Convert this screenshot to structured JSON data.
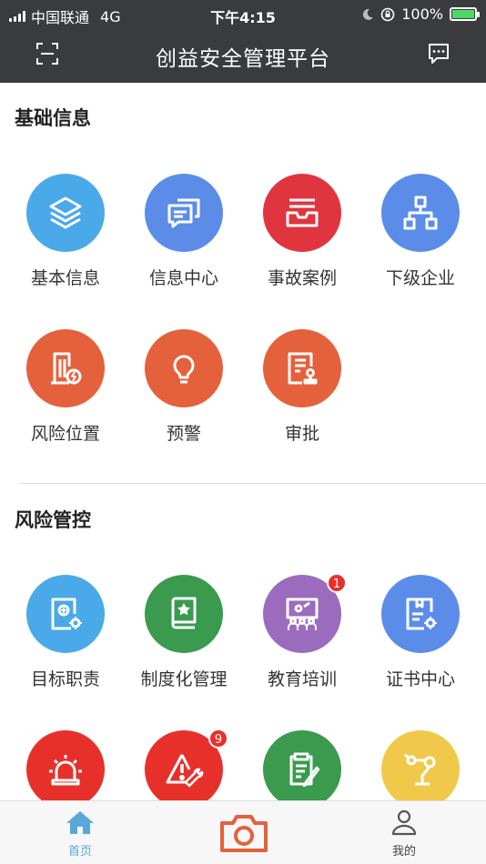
{
  "status_bar": {
    "carrier": "中国联通",
    "network": "4G",
    "time": "下午4:15",
    "battery": "100%"
  },
  "header": {
    "title": "创益安全管理平台"
  },
  "sections": [
    {
      "title": "基础信息",
      "items": [
        {
          "label": "基本信息",
          "icon": "layers-icon",
          "color": "#4aa9e8"
        },
        {
          "label": "信息中心",
          "icon": "chat-bubbles-icon",
          "color": "#5b8de8"
        },
        {
          "label": "事故案例",
          "icon": "inbox-tray-icon",
          "color": "#e0353f"
        },
        {
          "label": "下级企业",
          "icon": "org-chart-icon",
          "color": "#5b8de8"
        },
        {
          "label": "风险位置",
          "icon": "building-alert-icon",
          "color": "#e4613c"
        },
        {
          "label": "预警",
          "icon": "lightbulb-icon",
          "color": "#e4613c"
        },
        {
          "label": "审批",
          "icon": "document-approve-icon",
          "color": "#e4613c"
        }
      ]
    },
    {
      "title": "风险管控",
      "items": [
        {
          "label": "目标职责",
          "icon": "document-gear-icon",
          "color": "#4aa9e8"
        },
        {
          "label": "制度化管理",
          "icon": "book-star-icon",
          "color": "#3a9a4e"
        },
        {
          "label": "教育培训",
          "icon": "presentation-icon",
          "color": "#9b6bbd",
          "badge": "1"
        },
        {
          "label": "证书中心",
          "icon": "certificate-gear-icon",
          "color": "#5b8de8"
        },
        {
          "label": "",
          "icon": "alarm-light-icon",
          "color": "#e8302a"
        },
        {
          "label": "",
          "icon": "warning-wrench-icon",
          "color": "#e8302a",
          "badge": "9"
        },
        {
          "label": "",
          "icon": "clipboard-edit-icon",
          "color": "#3a9a4e"
        },
        {
          "label": "",
          "icon": "robot-arm-icon",
          "color": "#f1c94a"
        }
      ]
    }
  ],
  "tabbar": {
    "home_label": "首页",
    "mine_label": "我的",
    "active_color": "#5aa8d8",
    "camera_color": "#e4613c"
  }
}
